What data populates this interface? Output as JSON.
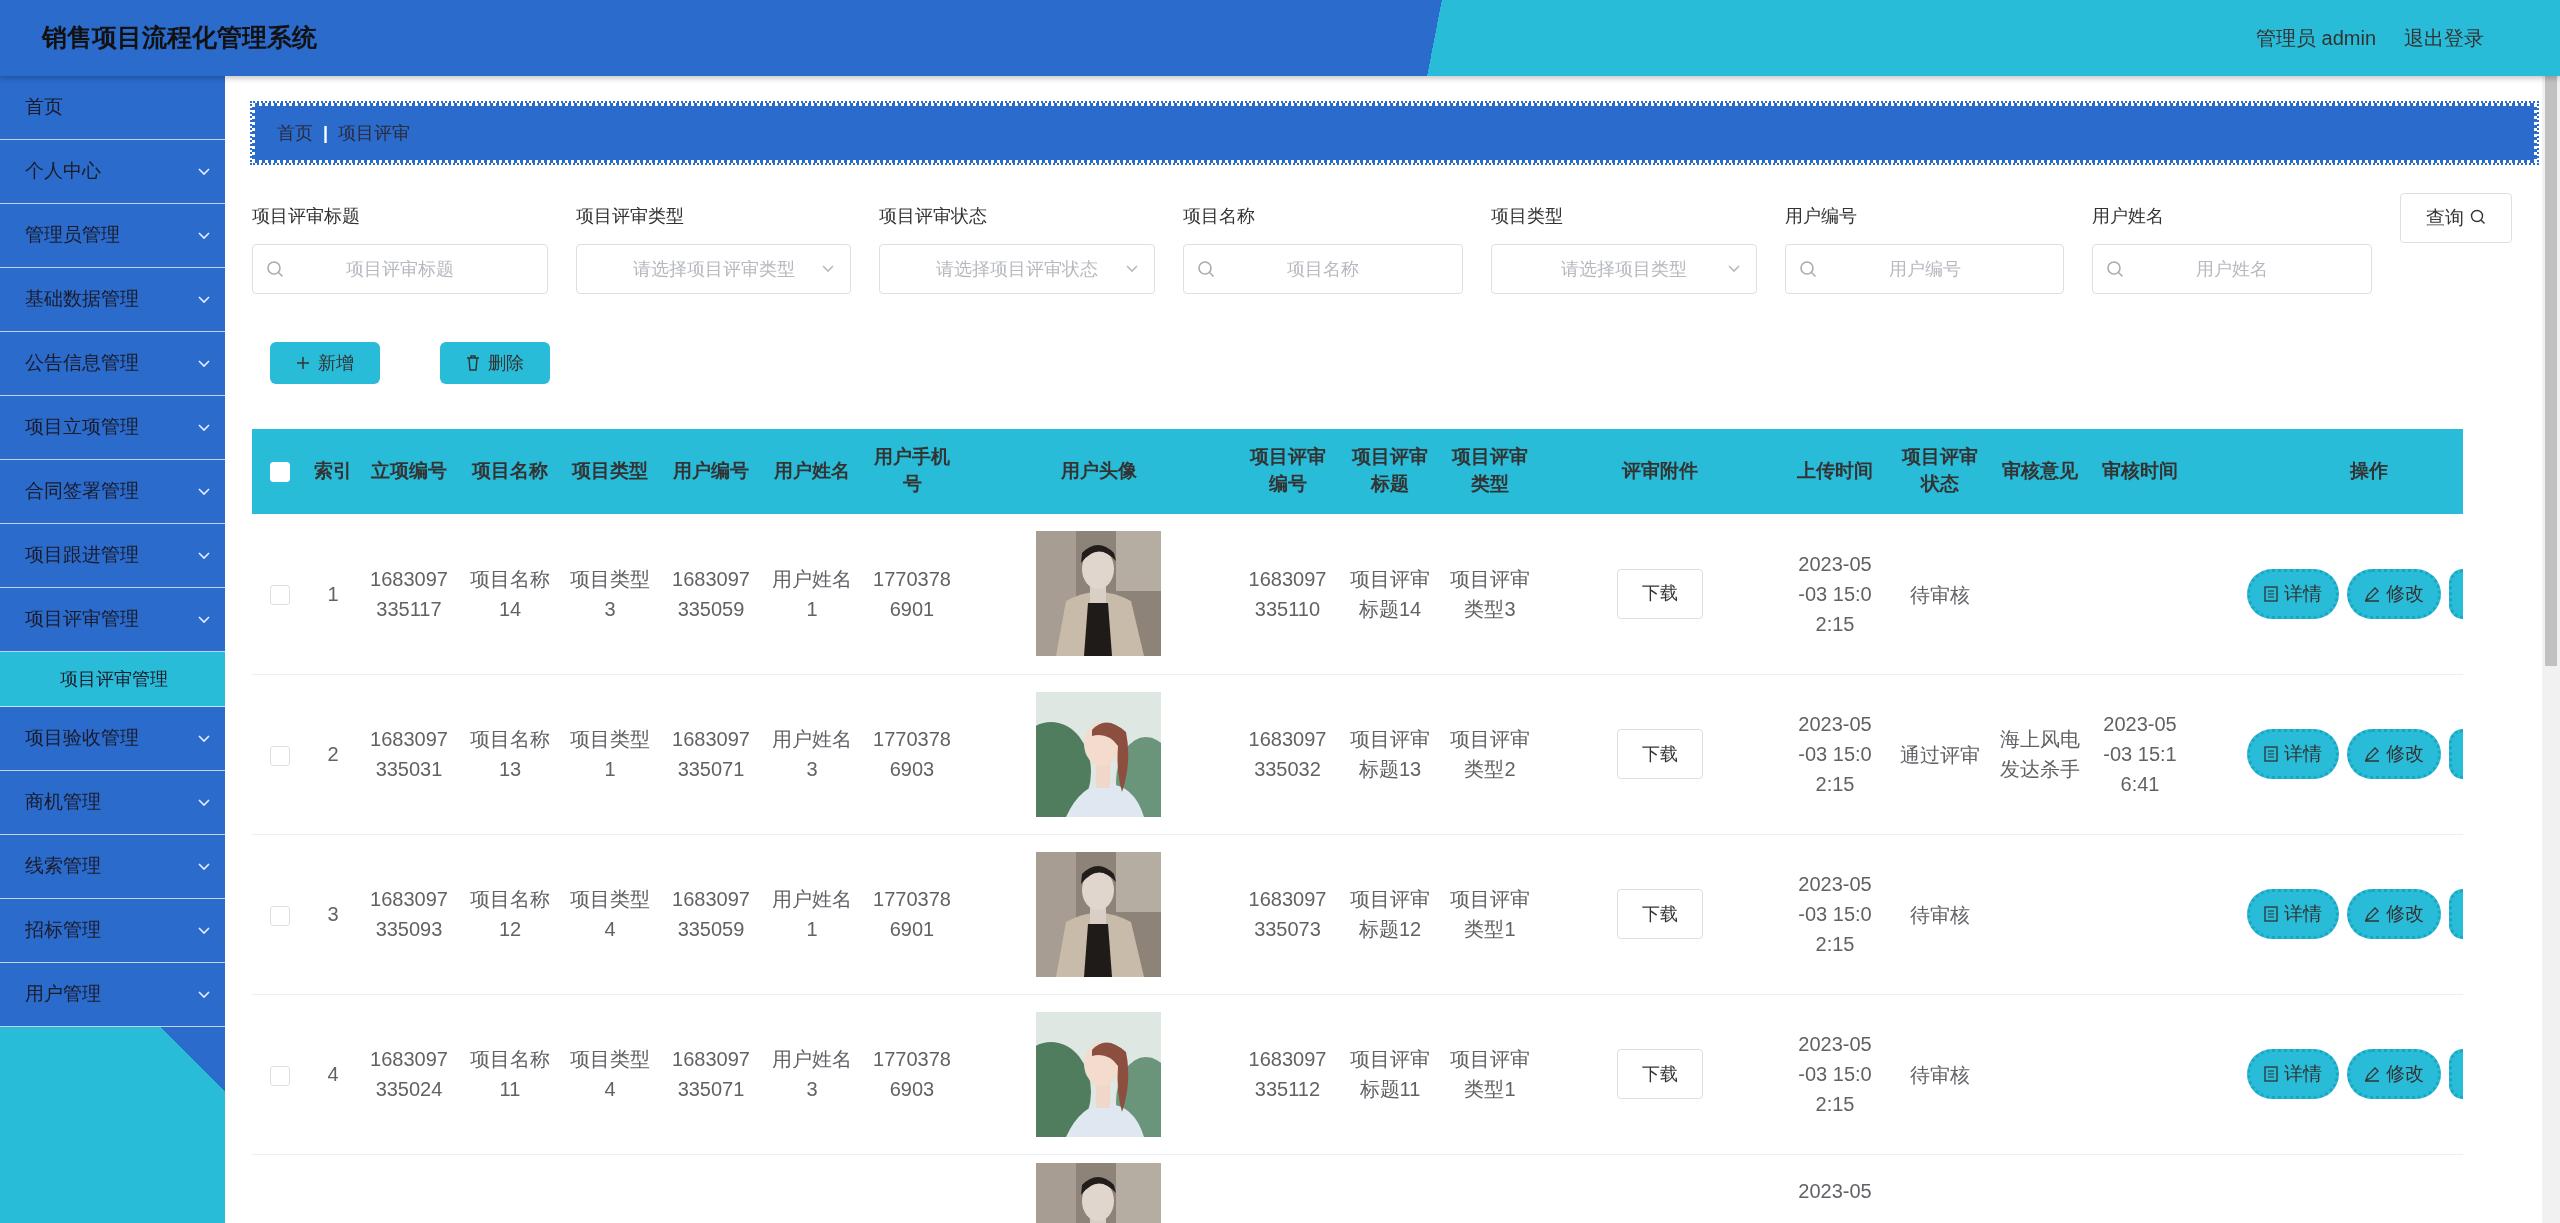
{
  "header": {
    "title": "销售项目流程化管理系统",
    "user": "管理员 admin",
    "logout": "退出登录"
  },
  "sidebar": {
    "items": [
      {
        "label": "首页",
        "kind": "link"
      },
      {
        "label": "个人中心",
        "kind": "submenu"
      },
      {
        "label": "管理员管理",
        "kind": "submenu"
      },
      {
        "label": "基础数据管理",
        "kind": "submenu"
      },
      {
        "label": "公告信息管理",
        "kind": "submenu"
      },
      {
        "label": "项目立项管理",
        "kind": "submenu"
      },
      {
        "label": "合同签署管理",
        "kind": "submenu"
      },
      {
        "label": "项目跟进管理",
        "kind": "submenu"
      },
      {
        "label": "项目评审管理",
        "kind": "submenu",
        "children": [
          {
            "label": "项目评审管理",
            "selected": true
          }
        ]
      },
      {
        "label": "项目验收管理",
        "kind": "submenu"
      },
      {
        "label": "商机管理",
        "kind": "submenu"
      },
      {
        "label": "线索管理",
        "kind": "submenu"
      },
      {
        "label": "招标管理",
        "kind": "submenu"
      },
      {
        "label": "用户管理",
        "kind": "submenu"
      }
    ]
  },
  "breadcrumb": {
    "items": [
      "首页",
      "项目评审"
    ],
    "separator": "|"
  },
  "search": {
    "fields": [
      {
        "label": "项目评审标题",
        "kind": "text",
        "placeholder": "项目评审标题"
      },
      {
        "label": "项目评审类型",
        "kind": "select",
        "placeholder": "请选择项目评审类型"
      },
      {
        "label": "项目评审状态",
        "kind": "select",
        "placeholder": "请选择项目评审状态"
      },
      {
        "label": "项目名称",
        "kind": "text",
        "placeholder": "项目名称"
      },
      {
        "label": "项目类型",
        "kind": "select",
        "placeholder": "请选择项目类型"
      },
      {
        "label": "用户编号",
        "kind": "text",
        "placeholder": "用户编号"
      },
      {
        "label": "用户姓名",
        "kind": "text",
        "placeholder": "用户姓名"
      }
    ],
    "button": "查询"
  },
  "actions": [
    {
      "label": "新增",
      "kind": "add"
    },
    {
      "label": "删除",
      "kind": "delete"
    }
  ],
  "table": {
    "select_all_checked": false,
    "columns": [
      "索引",
      "立项编号",
      "项目名称",
      "项目类型",
      "用户编号",
      "用户姓名",
      "用户手机号",
      "用户头像",
      "项目评审编号",
      "项目评审标题",
      "项目评审类型",
      "评审附件",
      "上传时间",
      "项目评审状态",
      "审核意见",
      "审核时间",
      "操作"
    ],
    "rows": [
      {
        "checked": false,
        "index": "1",
        "project_no": "1683097335117",
        "project_name": "项目名称14",
        "project_type": "项目类型3",
        "user_no": "1683097335059",
        "user_name": "用户姓名1",
        "phone": "17703786901",
        "review_no": "1683097335110",
        "review_title": "项目评审标题14",
        "review_type": "项目评审类型3",
        "attachment": "下载",
        "upload_time": "2023-05-03 15:02:15",
        "status": "待审核",
        "buttons": [
          "详情",
          "修改"
        ]
      },
      {
        "checked": false,
        "index": "2",
        "project_no": "1683097335031",
        "project_name": "项目名称13",
        "project_type": "项目类型1",
        "user_no": "1683097335071",
        "user_name": "用户姓名3",
        "phone": "17703786903",
        "review_no": "1683097335032",
        "review_title": "项目评审标题13",
        "review_type": "项目评审类型2",
        "attachment": "下载",
        "upload_time": "2023-05-03 15:02:15",
        "status": "通过评审",
        "opinion": "海上风电发达杀手",
        "review_time": "2023-05-03 15:16:41",
        "buttons": [
          "详情",
          "修改"
        ]
      },
      {
        "checked": false,
        "index": "3",
        "project_no": "1683097335093",
        "project_name": "项目名称12",
        "project_type": "项目类型4",
        "user_no": "1683097335059",
        "user_name": "用户姓名1",
        "phone": "17703786901",
        "review_no": "1683097335073",
        "review_title": "项目评审标题12",
        "review_type": "项目评审类型1",
        "attachment": "下载",
        "upload_time": "2023-05-03 15:02:15",
        "status": "待审核",
        "buttons": [
          "详情",
          "修改"
        ]
      },
      {
        "checked": false,
        "index": "4",
        "project_no": "1683097335024",
        "project_name": "项目名称11",
        "project_type": "项目类型4",
        "user_no": "1683097335071",
        "user_name": "用户姓名3",
        "phone": "17703786903",
        "review_no": "1683097335112",
        "review_title": "项目评审标题11",
        "review_type": "项目评审类型1",
        "attachment": "下载",
        "upload_time": "2023-05-03 15:02:15",
        "status": "待审核",
        "buttons": [
          "详情",
          "修改"
        ]
      },
      {
        "upload_time": "2023-05"
      }
    ]
  }
}
